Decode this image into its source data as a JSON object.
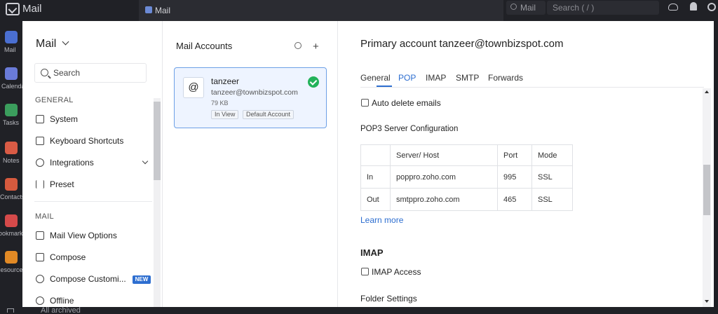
{
  "topbar": {
    "app_title": "Mail",
    "tab_label": "Mail",
    "search_scope": "Mail",
    "search_placeholder": "Search ( / )"
  },
  "rail": {
    "items": [
      {
        "label": "Mail",
        "icon": "mail-icon",
        "color": "#4a6fd1"
      },
      {
        "label": "Calendar",
        "icon": "calendar-icon",
        "color": "#6a7bd8"
      },
      {
        "label": "Tasks",
        "icon": "tasks-icon",
        "color": "#3b9e5d"
      },
      {
        "label": "Notes",
        "icon": "notes-icon",
        "color": "#d95b45"
      },
      {
        "label": "Contacts",
        "icon": "contacts-icon",
        "color": "#d65a3e"
      },
      {
        "label": "Bookmarks",
        "icon": "bookmark-icon",
        "color": "#d54a4a"
      },
      {
        "label": "Resources",
        "icon": "resources-icon",
        "color": "#e28a25"
      }
    ]
  },
  "sidebar": {
    "heading": "Mail",
    "search_placeholder": "Search",
    "general_label": "GENERAL",
    "general_items": [
      {
        "label": "System",
        "icon": "monitor-icon"
      },
      {
        "label": "Keyboard Shortcuts",
        "icon": "keyboard-icon"
      },
      {
        "label": "Integrations",
        "icon": "plug-icon"
      },
      {
        "label": "Preset",
        "icon": "sliders-icon"
      }
    ],
    "mail_label": "MAIL",
    "mail_items": [
      {
        "label": "Mail View Options",
        "icon": "layout-icon"
      },
      {
        "label": "Compose",
        "icon": "compose-icon"
      },
      {
        "label": "Compose Customi...",
        "icon": "customize-icon",
        "badge": "NEW"
      },
      {
        "label": "Offline",
        "icon": "offline-icon"
      }
    ]
  },
  "accounts": {
    "title": "Mail Accounts",
    "card": {
      "name": "tanzeer",
      "email": "tanzeer@townbizspot.com",
      "size": "79 KB",
      "tags": [
        "In View",
        "Default Account"
      ]
    }
  },
  "detail": {
    "title": "Primary account tanzeer@townbizspot.com",
    "tabs": [
      "General",
      "POP",
      "IMAP",
      "SMTP",
      "Forwards"
    ],
    "active_tab": "POP",
    "auto_delete_label": "Auto delete emails",
    "pop3_heading": "POP3 Server Configuration",
    "table": {
      "headers": [
        "",
        "Server/ Host",
        "Port",
        "Mode"
      ],
      "rows": [
        [
          "In",
          "poppro.zoho.com",
          "995",
          "SSL"
        ],
        [
          "Out",
          "smtppro.zoho.com",
          "465",
          "SSL"
        ]
      ]
    },
    "learn_more": "Learn more",
    "imap_heading": "IMAP",
    "imap_access_label": "IMAP Access",
    "folder_settings": "Folder Settings"
  },
  "bottom": {
    "text": "All archived"
  },
  "colors": {
    "accent": "#2d6ed0",
    "success": "#22b25a",
    "chrome": "#202126"
  }
}
